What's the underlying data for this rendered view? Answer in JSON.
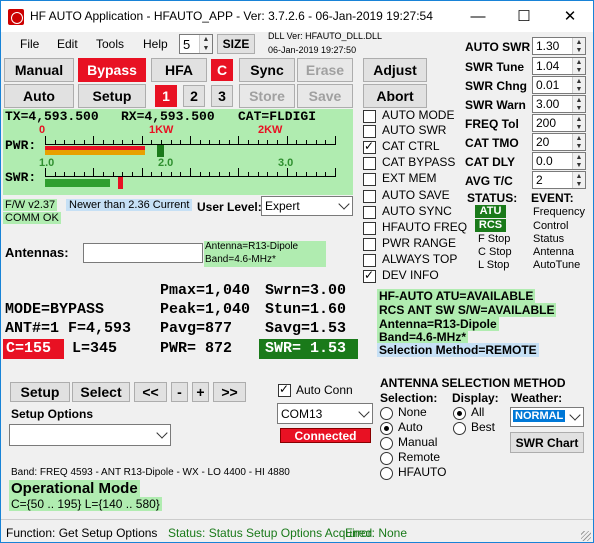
{
  "title": "HF AUTO Application - HFAUTO_APP - Ver: 3.7.2.6 - 06-Jan-2019 19:27:54",
  "menu": [
    "File",
    "Edit",
    "Tools",
    "Help"
  ],
  "menu_spin_value": "5",
  "size_label": "SIZE",
  "dll_ver": "DLL Ver: HFAUTO_DLL.DLL",
  "dll_date": "06-Jan-2019 19:27:50",
  "buttons": {
    "manual": "Manual",
    "bypass": "Bypass",
    "hfa": "HFA",
    "c": "C",
    "sync": "Sync",
    "erase": "Erase",
    "adjust": "Adjust",
    "auto": "Auto",
    "setup": "Setup",
    "b1": "1",
    "b2": "2",
    "b3": "3",
    "store": "Store",
    "save": "Save",
    "abort": "Abort"
  },
  "tx": "TX=4,593.500",
  "rx": "RX=4,593.500",
  "cat": "CAT=FLDIGI",
  "pwr_ticks": [
    "0",
    "1KW",
    "2KW"
  ],
  "pwr_label": "PWR:",
  "swr_ticks": [
    "1.0",
    "2.0",
    "3.0"
  ],
  "swr_label": "SWR:",
  "fw": "F/W v2.37",
  "newer": "Newer than 2.36 Current",
  "comm": "COMM OK",
  "user_level_label": "User Level:",
  "user_level": "Expert",
  "antennas_label": "Antennas:",
  "antenna_info": [
    "Antenna=R13-Dipole",
    "Band=4.6-MHz*"
  ],
  "status_left": {
    "mode": "MODE=BYPASS",
    "ant": "ANT#=1 F=4,593",
    "c": "C=155",
    "l": "L=345"
  },
  "status_mid": [
    "Pmax=1,040",
    "Peak=1,040",
    "Pavg=877",
    "PWR= 872"
  ],
  "status_right": [
    "Swrn=3.00",
    "Stun=1.60",
    "Savg=1.53",
    "SWR= 1.53"
  ],
  "right_info": [
    "HF-AUTO ATU=AVAILABLE",
    "RCS ANT SW S/W=AVAILABLE",
    "Antenna=R13-Dipole",
    "Band=4.6-MHz*",
    "Selection Method=REMOTE"
  ],
  "checks": [
    {
      "label": "AUTO MODE",
      "on": false
    },
    {
      "label": "AUTO SWR",
      "on": false
    },
    {
      "label": "CAT CTRL",
      "on": true
    },
    {
      "label": "CAT BYPASS",
      "on": false
    },
    {
      "label": "EXT MEM",
      "on": false
    },
    {
      "label": "AUTO SAVE",
      "on": false
    },
    {
      "label": "AUTO SYNC",
      "on": false
    },
    {
      "label": "HFAUTO FREQ",
      "on": false
    },
    {
      "label": "PWR RANGE",
      "on": false
    },
    {
      "label": "ALWAYS TOP",
      "on": false
    },
    {
      "label": "DEV INFO",
      "on": true
    }
  ],
  "params": [
    {
      "label": "AUTO SWR",
      "value": "1.30"
    },
    {
      "label": "SWR Tune",
      "value": "1.04"
    },
    {
      "label": "SWR Chng",
      "value": "0.01"
    },
    {
      "label": "SWR Warn",
      "value": "3.00"
    },
    {
      "label": "FREQ Tol",
      "value": "200"
    },
    {
      "label": "CAT TMO",
      "value": "20"
    },
    {
      "label": "CAT DLY",
      "value": "0.0"
    },
    {
      "label": "AVG T/C",
      "value": "2"
    }
  ],
  "status_label": "STATUS:",
  "event_label": "EVENT:",
  "status_items": [
    "ATU",
    "RCS",
    "F Stop",
    "C Stop",
    "L Stop"
  ],
  "event_items": [
    "Frequency",
    "Control",
    "Status",
    "Antenna",
    "AutoTune"
  ],
  "bottom_buttons": {
    "setup": "Setup",
    "select": "Select",
    "prev": "<<",
    "minus": "-",
    "plus": "+",
    "next": ">>"
  },
  "setup_options_label": "Setup Options",
  "auto_conn": "Auto Conn",
  "com_port": "COM13",
  "connected": "Connected",
  "ant_sel_title": "ANTENNA SELECTION METHOD",
  "selection_label": "Selection:",
  "selection_opts": [
    {
      "label": "None",
      "on": false
    },
    {
      "label": "Auto",
      "on": true
    },
    {
      "label": "Manual",
      "on": false
    },
    {
      "label": "Remote",
      "on": false
    },
    {
      "label": "HFAUTO",
      "on": false
    }
  ],
  "display_label": "Display:",
  "display_opts": [
    {
      "label": "All",
      "on": true
    },
    {
      "label": "Best",
      "on": false
    }
  ],
  "weather_label": "Weather:",
  "weather_value": "NORMAL",
  "swr_chart": "SWR Chart",
  "band_line": "Band:    FREQ 4593 - ANT R13-Dipole - WX  - LO 4400 - HI 4880",
  "op_mode": "Operational Mode",
  "op_range": "C={50 .. 195}  L={140 .. 580}",
  "footer": {
    "function": "Function: Get Setup Options",
    "status": "Status: Status Setup Options Acquired",
    "error": "Error: None"
  },
  "colors": {
    "accent_green": "#b0ecb0",
    "red": "#e81123",
    "dark_green": "#1a7a1a",
    "blue_info": "#c6e0f5"
  }
}
